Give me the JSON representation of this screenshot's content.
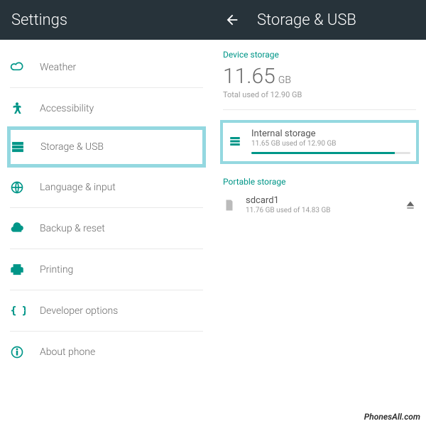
{
  "left": {
    "title": "Settings",
    "items": [
      {
        "label": "Weather"
      },
      {
        "label": "Accessibility"
      },
      {
        "label": "Storage & USB"
      },
      {
        "label": "Language & input"
      },
      {
        "label": "Backup & reset"
      },
      {
        "label": "Printing"
      },
      {
        "label": "Developer options"
      },
      {
        "label": "About phone"
      }
    ]
  },
  "right": {
    "title": "Storage & USB",
    "device_section_label": "Device storage",
    "total_used_value": "11.65",
    "total_used_unit": "GB",
    "total_used_subtext": "Total used of 12.90 GB",
    "internal": {
      "title": "Internal storage",
      "subtext": "11.65 GB used of 12.90 GB",
      "percent": 90
    },
    "portable_section_label": "Portable storage",
    "sdcard": {
      "title": "sdcard1",
      "subtext": "11.76 GB used of 14.83 GB"
    }
  },
  "watermark": "PhonesAll.com"
}
